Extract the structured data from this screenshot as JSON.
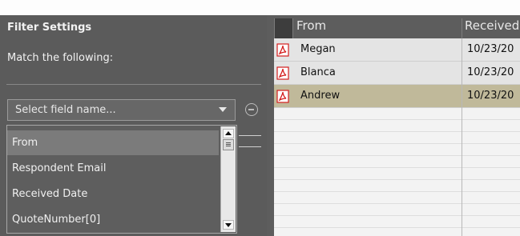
{
  "filter": {
    "title": "Filter Settings",
    "match_label": "Match the following:",
    "field_select": {
      "value": "Select field name...",
      "options": [
        "From",
        "Respondent Email",
        "Received Date",
        "QuoteNumber[0]"
      ],
      "selected_option": "From"
    }
  },
  "table": {
    "columns": [
      "From",
      "Received"
    ],
    "rows": [
      {
        "from": "Megan",
        "date": "10/23/20",
        "icon": "pdf-icon"
      },
      {
        "from": "Blanca",
        "date": "10/23/20",
        "icon": "pdf-icon"
      },
      {
        "from": "Andrew",
        "date": "10/23/20",
        "icon": "pdf-icon",
        "selected": true
      }
    ]
  },
  "colors": {
    "panel_bg": "#5b5b5b",
    "selected_row": "#c0b99a",
    "pdf_red": "#d41d1d"
  }
}
